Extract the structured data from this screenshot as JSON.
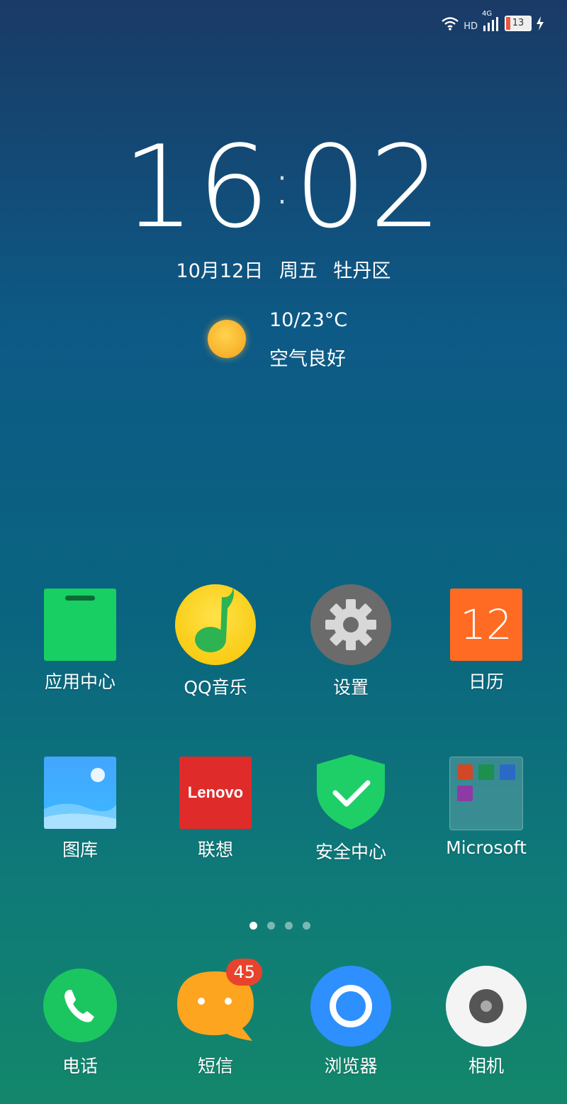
{
  "status": {
    "network": "4G",
    "hd": "HD",
    "battery": "13"
  },
  "lockscreen": {
    "hour": "16",
    "minute": "02",
    "date": "10月12日  周五  牡丹区",
    "temperature": "10/23°C",
    "air_quality": "空气良好"
  },
  "apps_row1": [
    {
      "label": "应用中心",
      "icon": "app-store-icon"
    },
    {
      "label": "QQ音乐",
      "icon": "qq-music-icon"
    },
    {
      "label": "设置",
      "icon": "gear-icon"
    },
    {
      "label": "日历",
      "icon": "calendar-icon",
      "day": "12"
    }
  ],
  "apps_row2": [
    {
      "label": "图库",
      "icon": "gallery-icon"
    },
    {
      "label": "联想",
      "icon": "lenovo-icon",
      "logo_text": "Lenovo"
    },
    {
      "label": "安全中心",
      "icon": "shield-check-icon"
    },
    {
      "label": "Microsoft",
      "icon": "folder-icon"
    }
  ],
  "dock": [
    {
      "label": "电话",
      "icon": "phone-icon"
    },
    {
      "label": "短信",
      "icon": "message-icon",
      "badge": "45"
    },
    {
      "label": "浏览器",
      "icon": "browser-icon"
    },
    {
      "label": "相机",
      "icon": "camera-icon"
    }
  ],
  "page_indicator": {
    "count": 4,
    "active": 1
  }
}
